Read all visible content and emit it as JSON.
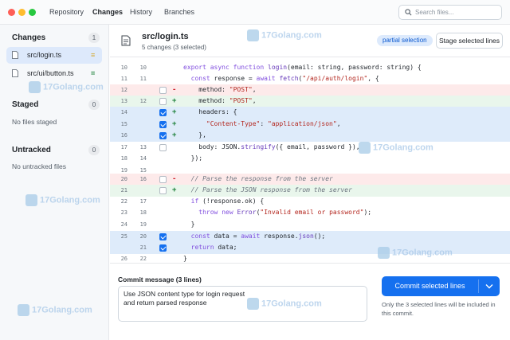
{
  "nav": {
    "tabs": [
      "Repository",
      "Changes",
      "History",
      "Branches"
    ],
    "search_placeholder": "Search files..."
  },
  "sidebar": {
    "changes": {
      "title": "Changes",
      "count": "1",
      "files": [
        {
          "name": "src/login.ts",
          "mark": "≡",
          "color": "#d4a72c"
        },
        {
          "name": "src/ui/button.ts",
          "mark": "=",
          "color": "#1a7f37"
        }
      ]
    },
    "staged": {
      "title": "Staged",
      "count": "0",
      "empty": "No files staged"
    },
    "untracked": {
      "title": "Untracked",
      "count": "0",
      "empty": "No untracked files"
    }
  },
  "file": {
    "name": "src/login.ts",
    "summary": "5 changes (3 selected)",
    "badge": "partial selection",
    "stage_button": "Stage selected lines"
  },
  "diff": [
    {
      "old": "10",
      "new": "10",
      "kind": "ctx",
      "checked": false,
      "text": "export async function login(email: string, password: string) {"
    },
    {
      "old": "11",
      "new": "11",
      "kind": "ctx",
      "checked": false,
      "text": "  const response = await fetch(\"/api/auth/login\", {"
    },
    {
      "old": "12",
      "new": "",
      "kind": "del",
      "checked": false,
      "text": "    method: \"POST\","
    },
    {
      "old": "13",
      "new": "12",
      "kind": "add",
      "checked": false,
      "text": "    method: \"POST\","
    },
    {
      "old": "14",
      "new": "",
      "kind": "add",
      "checked": true,
      "text": "    headers: {"
    },
    {
      "old": "15",
      "new": "",
      "kind": "add",
      "checked": true,
      "text": "      \"Content-Type\": \"application/json\","
    },
    {
      "old": "16",
      "new": "",
      "kind": "add",
      "checked": true,
      "text": "    },"
    },
    {
      "old": "17",
      "new": "13",
      "kind": "ctx",
      "checked": false,
      "text": "    body: JSON.stringify({ email, password }),"
    },
    {
      "old": "18",
      "new": "14",
      "kind": "ctx",
      "checked": false,
      "text": "  });"
    },
    {
      "old": "19",
      "new": "15",
      "kind": "blank",
      "checked": false,
      "text": ""
    },
    {
      "old": "20",
      "new": "16",
      "kind": "del",
      "checked": false,
      "text": "  // Parse the response from the server"
    },
    {
      "old": "21",
      "new": "",
      "kind": "add",
      "checked": false,
      "text": "  // Parse the JSON response from the server"
    },
    {
      "old": "22",
      "new": "17",
      "kind": "ctx",
      "checked": false,
      "text": "  if (!response.ok) {"
    },
    {
      "old": "23",
      "new": "18",
      "kind": "ctx",
      "checked": false,
      "text": "    throw new Error(\"Invalid email or password\");"
    },
    {
      "old": "24",
      "new": "19",
      "kind": "ctx",
      "checked": false,
      "text": "  }"
    },
    {
      "old": "25",
      "new": "20",
      "kind": "sel",
      "checked": true,
      "text": "  const data = await response.json();"
    },
    {
      "old": "",
      "new": "21",
      "kind": "sel",
      "checked": true,
      "text": "  return data;"
    },
    {
      "old": "26",
      "new": "22",
      "kind": "ctx",
      "checked": false,
      "text": "}"
    }
  ],
  "commit": {
    "label": "Commit message (3 lines)",
    "message": "Use JSON content type for login request\nand return parsed response",
    "button": "Commit selected lines",
    "note": "Only the 3 selected lines will be included in this commit."
  },
  "watermark": {
    "text": "17Golang.com"
  }
}
